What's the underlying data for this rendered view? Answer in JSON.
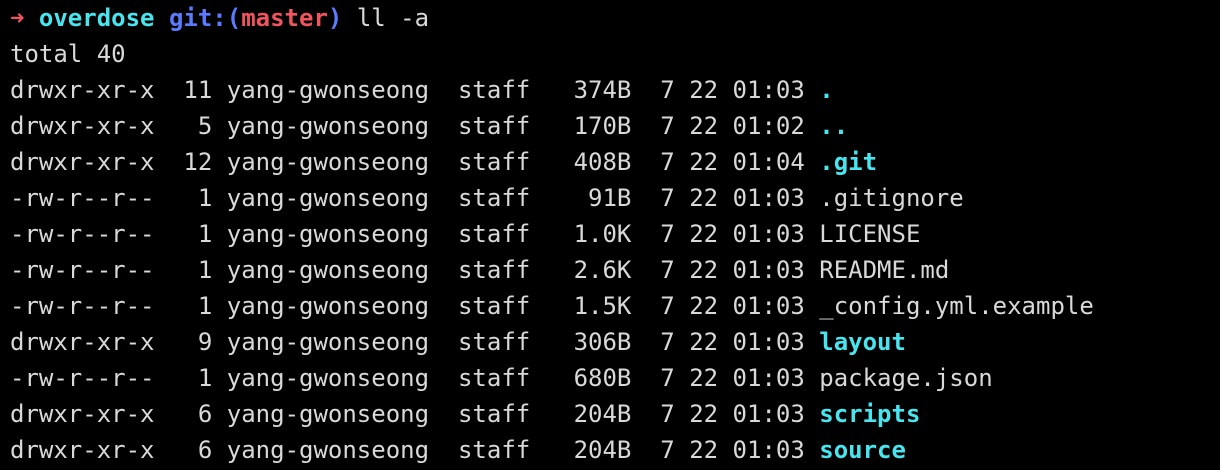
{
  "prompt": {
    "arrow": "➜",
    "dir": "overdose",
    "git_label": "git:",
    "paren_open": "(",
    "branch": "master",
    "paren_close": ")",
    "command": "ll -a"
  },
  "total_line": "total 40",
  "colors": {
    "arrow": "#f0555f",
    "dir": "#48e5ef",
    "git": "#5b7bff",
    "branch": "#f0555f",
    "text": "#d9d9d9",
    "directory_entry": "#48e5ef"
  },
  "entries": [
    {
      "perm": "drwxr-xr-x",
      "links": "11",
      "owner": "yang-gwonseong",
      "group": "staff",
      "size": "374B",
      "month": "7",
      "day": "22",
      "time": "01:03",
      "name": ".",
      "is_dir": true
    },
    {
      "perm": "drwxr-xr-x",
      "links": "5",
      "owner": "yang-gwonseong",
      "group": "staff",
      "size": "170B",
      "month": "7",
      "day": "22",
      "time": "01:02",
      "name": "..",
      "is_dir": true
    },
    {
      "perm": "drwxr-xr-x",
      "links": "12",
      "owner": "yang-gwonseong",
      "group": "staff",
      "size": "408B",
      "month": "7",
      "day": "22",
      "time": "01:04",
      "name": ".git",
      "is_dir": true
    },
    {
      "perm": "-rw-r--r--",
      "links": "1",
      "owner": "yang-gwonseong",
      "group": "staff",
      "size": "91B",
      "month": "7",
      "day": "22",
      "time": "01:03",
      "name": ".gitignore",
      "is_dir": false
    },
    {
      "perm": "-rw-r--r--",
      "links": "1",
      "owner": "yang-gwonseong",
      "group": "staff",
      "size": "1.0K",
      "month": "7",
      "day": "22",
      "time": "01:03",
      "name": "LICENSE",
      "is_dir": false
    },
    {
      "perm": "-rw-r--r--",
      "links": "1",
      "owner": "yang-gwonseong",
      "group": "staff",
      "size": "2.6K",
      "month": "7",
      "day": "22",
      "time": "01:03",
      "name": "README.md",
      "is_dir": false
    },
    {
      "perm": "-rw-r--r--",
      "links": "1",
      "owner": "yang-gwonseong",
      "group": "staff",
      "size": "1.5K",
      "month": "7",
      "day": "22",
      "time": "01:03",
      "name": "_config.yml.example",
      "is_dir": false
    },
    {
      "perm": "drwxr-xr-x",
      "links": "9",
      "owner": "yang-gwonseong",
      "group": "staff",
      "size": "306B",
      "month": "7",
      "day": "22",
      "time": "01:03",
      "name": "layout",
      "is_dir": true
    },
    {
      "perm": "-rw-r--r--",
      "links": "1",
      "owner": "yang-gwonseong",
      "group": "staff",
      "size": "680B",
      "month": "7",
      "day": "22",
      "time": "01:03",
      "name": "package.json",
      "is_dir": false
    },
    {
      "perm": "drwxr-xr-x",
      "links": "6",
      "owner": "yang-gwonseong",
      "group": "staff",
      "size": "204B",
      "month": "7",
      "day": "22",
      "time": "01:03",
      "name": "scripts",
      "is_dir": true
    },
    {
      "perm": "drwxr-xr-x",
      "links": "6",
      "owner": "yang-gwonseong",
      "group": "staff",
      "size": "204B",
      "month": "7",
      "day": "22",
      "time": "01:03",
      "name": "source",
      "is_dir": true
    }
  ]
}
